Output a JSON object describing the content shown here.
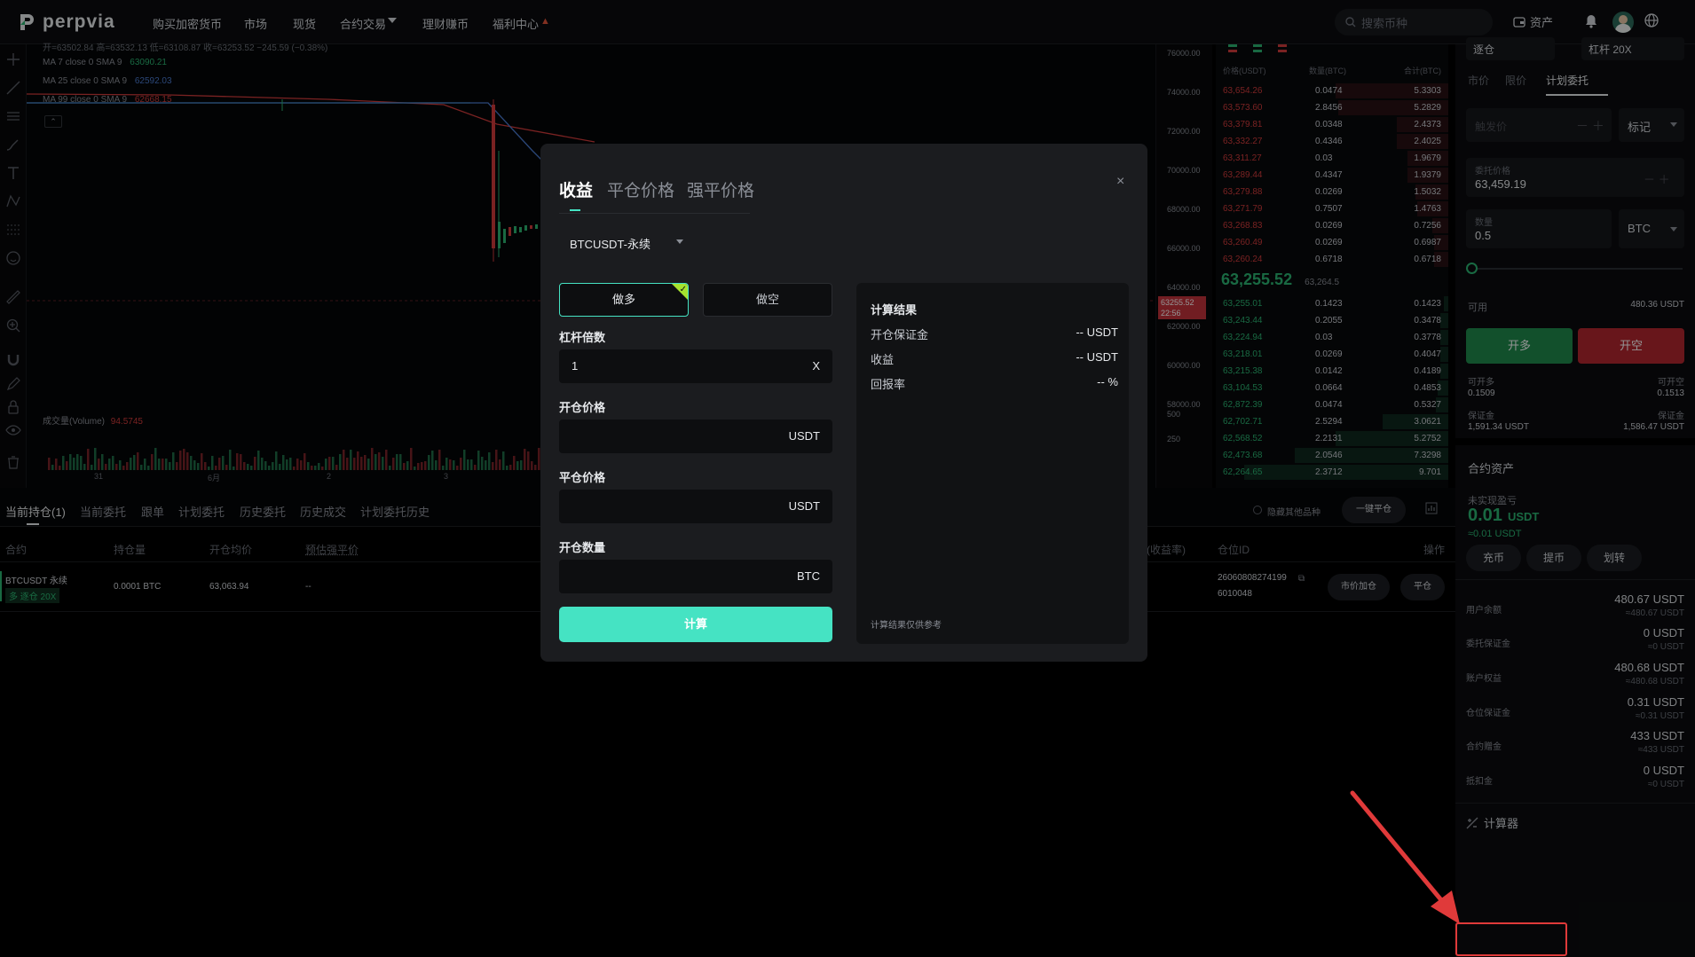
{
  "nav": {
    "brand": "perpvia",
    "items": [
      "购买加密货币",
      "市场",
      "现货",
      "合约交易",
      "理财赚币",
      "福利中心"
    ],
    "search_placeholder": "搜索币种",
    "assets_label": "资产"
  },
  "chart": {
    "ohlc_line": "开=63502.84 高=63532.13 低=63108.87 收=63253.52 −245.59 (−0.38%)",
    "ma7_label": "MA 7 close 0 SMA 9",
    "ma7_value": "63090.21",
    "ma25_label": "MA 25 close 0 SMA 9",
    "ma25_value": "62592.03",
    "ma99_label": "MA 99 close 0 SMA 9",
    "ma99_value": "62668.15",
    "volume_label": "成交量(Volume)",
    "volume_value": "94.5745",
    "x_ticks": [
      "31",
      "6月",
      "2",
      "3"
    ],
    "price_ticks": [
      "76000.00",
      "74000.00",
      "72000.00",
      "70000.00",
      "68000.00",
      "66000.00",
      "64000.00",
      "62000.00",
      "60000.00",
      "58000.00"
    ],
    "vol_ticks": [
      "500",
      "250"
    ],
    "current_price": "63255.52",
    "current_time": "22:56",
    "colors": {
      "ma7": "#2bb673",
      "ma25": "#4a7bd1",
      "ma99": "#d23c3c",
      "up": "#2bb673",
      "down": "#d23c3c"
    }
  },
  "orderbook": {
    "headers": [
      "价格(USDT)",
      "数量(BTC)",
      "合计(BTC)"
    ],
    "asks": [
      [
        "63,654.26",
        "0.0474",
        "5.3303"
      ],
      [
        "63,573.60",
        "2.8456",
        "5.2829"
      ],
      [
        "63,379.81",
        "0.0348",
        "2.4373"
      ],
      [
        "63,332.27",
        "0.4346",
        "2.4025"
      ],
      [
        "63,311.27",
        "0.03",
        "1.9679"
      ],
      [
        "63,289.44",
        "0.4347",
        "1.9379"
      ],
      [
        "63,279.88",
        "0.0269",
        "1.5032"
      ],
      [
        "63,271.79",
        "0.7507",
        "1.4763"
      ],
      [
        "63,268.83",
        "0.0269",
        "0.7256"
      ],
      [
        "63,260.49",
        "0.0269",
        "0.6987"
      ],
      [
        "63,260.24",
        "0.6718",
        "0.6718"
      ]
    ],
    "last_price": "63,255.52",
    "mark_price": "63,264.5",
    "bids": [
      [
        "63,255.01",
        "0.1423",
        "0.1423"
      ],
      [
        "63,243.44",
        "0.2055",
        "0.3478"
      ],
      [
        "63,224.94",
        "0.03",
        "0.3778"
      ],
      [
        "63,218.01",
        "0.0269",
        "0.4047"
      ],
      [
        "63,215.38",
        "0.0142",
        "0.4189"
      ],
      [
        "63,104.53",
        "0.0664",
        "0.4853"
      ],
      [
        "62,872.39",
        "0.0474",
        "0.5327"
      ],
      [
        "62,702.71",
        "2.5294",
        "3.0621"
      ],
      [
        "62,568.52",
        "2.2131",
        "5.2752"
      ],
      [
        "62,473.68",
        "2.0546",
        "7.3298"
      ],
      [
        "62,264.65",
        "2.3712",
        "9.701"
      ]
    ],
    "ask_depth_fractions": [
      0.55,
      0.54,
      0.25,
      0.25,
      0.2,
      0.2,
      0.16,
      0.15,
      0.08,
      0.07,
      0.07
    ],
    "bid_depth_fractions": [
      0.02,
      0.04,
      0.04,
      0.04,
      0.04,
      0.05,
      0.06,
      0.32,
      0.55,
      0.75,
      1.0
    ]
  },
  "trade": {
    "mode_label": "逐仓",
    "leverage_label": "杠杆 20X",
    "tabs": [
      "市价",
      "限价",
      "计划委托"
    ],
    "trigger_placeholder": "触发价",
    "trigger_type": "标记",
    "order_price_label": "委托价格",
    "order_price": "63,459.19",
    "qty_label": "数量",
    "qty": "0.5",
    "qty_unit": "BTC",
    "available_label": "可用",
    "available_value": "480.36 USDT",
    "open_long": "开多",
    "open_short": "开空",
    "can_long_label": "可开多",
    "can_long": "0.1509",
    "can_short_label": "可开空",
    "can_short": "0.1513",
    "margin_label": "保证金",
    "margin_long": "1,591.34 USDT",
    "margin_short": "1,586.47 USDT"
  },
  "assets": {
    "title": "合约资产",
    "unrealized_label": "未实现盈亏",
    "unrealized_value": "0.01",
    "unrealized_unit": "USDT",
    "unrealized_approx": "≈0.01 USDT",
    "buttons": [
      "充币",
      "提币",
      "划转"
    ],
    "rows": [
      {
        "label": "用户余额",
        "value": "480.67 USDT",
        "approx": "≈480.67 USDT"
      },
      {
        "label": "委托保证金",
        "value": "0 USDT",
        "approx": "≈0 USDT"
      },
      {
        "label": "账户权益",
        "value": "480.68 USDT",
        "approx": "≈480.68 USDT"
      },
      {
        "label": "仓位保证金",
        "value": "0.31 USDT",
        "approx": "≈0.31 USDT"
      },
      {
        "label": "合约赠金",
        "value": "433 USDT",
        "approx": "≈433 USDT"
      },
      {
        "label": "抵扣金",
        "value": "0 USDT",
        "approx": "≈0 USDT"
      }
    ],
    "calculator_label": "计算器"
  },
  "positions": {
    "tabs": [
      "当前持仓(1)",
      "当前委托",
      "跟单",
      "计划委托",
      "历史委托",
      "历史成交",
      "计划委托历史"
    ],
    "hide_other_label": "隐藏其他品种",
    "close_all_label": "一键平仓",
    "columns": [
      "合约",
      "持仓量",
      "开仓均价",
      "预估强平价",
      "(收益率)",
      "仓位ID",
      "操作"
    ],
    "row": {
      "symbol": "BTCUSDT 永续",
      "tag": "多 逐仓 20X",
      "size": "0.0001 BTC",
      "entry": "63,063.94",
      "liq": "--",
      "position_id_1": "26060808274199",
      "position_id_2": "6010048",
      "add_margin": "市价加仓",
      "close": "平仓"
    }
  },
  "modal": {
    "tabs": [
      "收益",
      "平仓价格",
      "强平价格"
    ],
    "symbol": "BTCUSDT-永续",
    "long": "做多",
    "short": "做空",
    "leverage_label": "杠杆倍数",
    "leverage_value": "1",
    "leverage_suffix": "X",
    "open_price_label": "开仓价格",
    "close_price_label": "平仓价格",
    "qty_label": "开仓数量",
    "usdt": "USDT",
    "btc": "BTC",
    "calc_button": "计算",
    "result_title": "计算结果",
    "result_rows": [
      {
        "k": "开仓保证金",
        "v": "-- USDT"
      },
      {
        "k": "收益",
        "v": "-- USDT"
      },
      {
        "k": "回报率",
        "v": "-- %"
      }
    ],
    "disclaimer": "计算结果仅供参考",
    "accent": "#45e3c3"
  }
}
